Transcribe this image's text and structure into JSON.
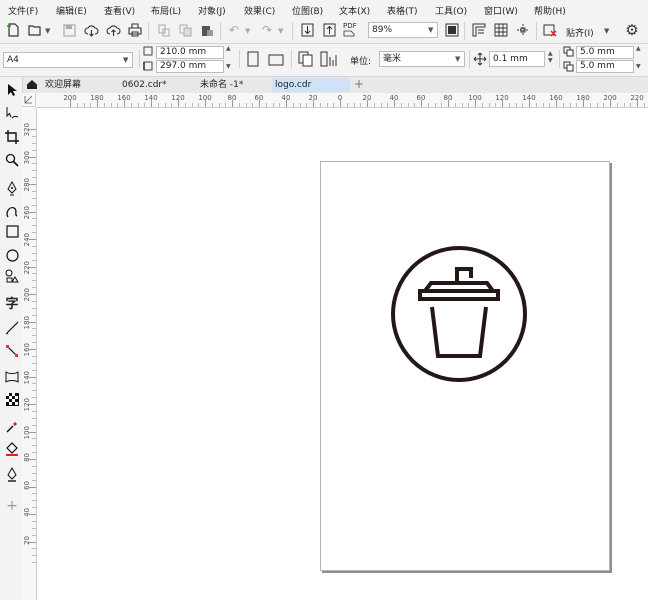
{
  "menu": [
    "文件(F)",
    "编辑(E)",
    "查看(V)",
    "布局(L)",
    "对象(J)",
    "效果(C)",
    "位图(B)",
    "文本(X)",
    "表格(T)",
    "工具(O)",
    "窗口(W)",
    "帮助(H)"
  ],
  "toolbar": {
    "zoom": "89%",
    "pdf_label": "PDF",
    "snap_label": "贴齐(I)"
  },
  "property_bar": {
    "page_size": "A4",
    "width": "210.0 mm",
    "height": "297.0 mm",
    "unit_label": "单位:",
    "unit_value": "毫米",
    "nudge": "0.1 mm",
    "dup_x": "5.0 mm",
    "dup_y": "5.0 mm"
  },
  "tabs": [
    "欢迎屏幕",
    "0602.cdr*",
    "未命名 -1*",
    "logo.cdr"
  ],
  "active_tab": "logo.cdr",
  "ruler_h": [
    "200",
    "180",
    "160",
    "140",
    "120",
    "100",
    "80",
    "60",
    "40",
    "20",
    "0",
    "20",
    "40",
    "60",
    "80",
    "100",
    "120",
    "140",
    "160",
    "180",
    "200",
    "220"
  ],
  "ruler_v": [
    "320",
    "300",
    "280",
    "260",
    "240",
    "220",
    "200",
    "180",
    "160",
    "140",
    "120",
    "100",
    "80",
    "60",
    "40",
    "20"
  ],
  "colors": {
    "accent_tab": "#cfe2f7",
    "logo_stroke": "#231815"
  },
  "drawing": {
    "logo": "cup-with-straw-in-circle-icon"
  }
}
